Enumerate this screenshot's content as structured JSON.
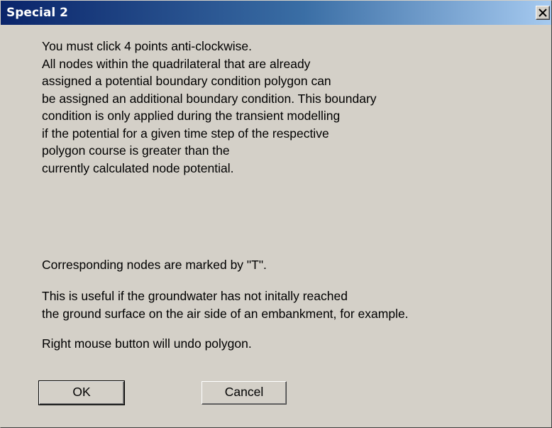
{
  "window": {
    "title": "Special 2"
  },
  "message": {
    "lines": [
      "You must click 4 points anti-clockwise.",
      "All nodes within the quadrilateral that are already",
      "assigned a potential boundary condition polygon can",
      "be assigned an additional boundary condition. This boundary",
      "condition is only applied during the transient modelling",
      "if the potential for a given time step of the respective",
      "polygon course is greater than the",
      "currently calculated node potential."
    ],
    "nodes_note": "Corresponding nodes are marked by \"T\".",
    "useful_lines": [
      "This is useful if the groundwater has not initally reached",
      "the ground surface on the air side of an embankment, for example."
    ],
    "undo_note": "Right mouse button will undo polygon."
  },
  "buttons": {
    "ok_label": "OK",
    "cancel_label": "Cancel"
  },
  "colors": {
    "title_gradient_start": "#0a246a",
    "title_gradient_end": "#a6caf0",
    "dialog_background": "#d4d0c8"
  },
  "icons": {
    "close": "close-icon"
  }
}
